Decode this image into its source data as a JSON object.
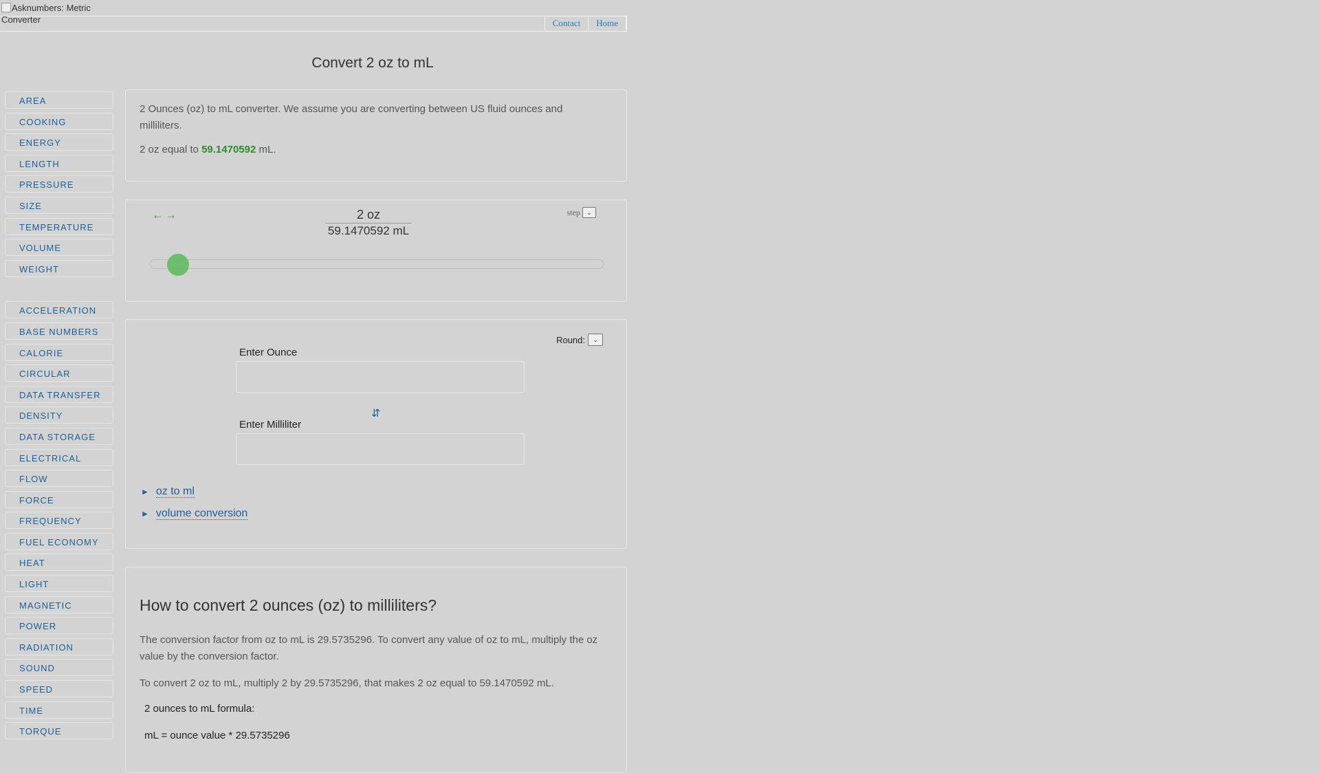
{
  "header": {
    "logo_alt": "Asknumbers: Metric Converter",
    "nav": [
      "Contact",
      "Home"
    ]
  },
  "title": "Convert 2 oz to mL",
  "sidebar": {
    "primary": [
      "AREA",
      "COOKING",
      "ENERGY",
      "LENGTH",
      "PRESSURE",
      "SIZE",
      "TEMPERATURE",
      "VOLUME",
      "WEIGHT"
    ],
    "secondary": [
      "ACCELERATION",
      "BASE NUMBERS",
      "CALORIE",
      "CIRCULAR",
      "DATA TRANSFER",
      "DENSITY",
      "DATA STORAGE",
      "ELECTRICAL",
      "FLOW",
      "FORCE",
      "FREQUENCY",
      "FUEL ECONOMY",
      "HEAT",
      "LIGHT",
      "MAGNETIC",
      "POWER",
      "RADIATION",
      "SOUND",
      "SPEED",
      "TIME",
      "TORQUE"
    ]
  },
  "summary": {
    "intro": "2 Ounces (oz) to mL converter. We assume you are converting between US fluid ounces and milliliters.",
    "equal_prefix": "2 oz equal to ",
    "equal_value": "59.1470592",
    "equal_suffix": " mL."
  },
  "slider": {
    "oz_display": "2 oz",
    "ml_display": "59.1470592 mL",
    "step_label": "step",
    "position_fraction": 0.02
  },
  "converter": {
    "round_label": "Round:",
    "ounce_label": "Enter Ounce",
    "ounce_value": "",
    "milliliter_label": "Enter Milliliter",
    "milliliter_value": "",
    "swap_icon": "⇵",
    "related": [
      "oz to ml",
      "volume conversion"
    ]
  },
  "howto": {
    "heading": "How to convert 2 ounces (oz) to milliliters?",
    "p1": "The conversion factor from oz to mL is 29.5735296. To convert any value of oz to mL, multiply the oz value by the conversion factor.",
    "p2": "To convert 2 oz to mL, multiply 2 by 29.5735296, that makes 2 oz equal to 59.1470592 mL.",
    "formula_title": "2 ounces to mL formula:",
    "formula": "mL = ounce value * 29.5735296"
  },
  "colors": {
    "link": "#1d5f97",
    "highlight": "#2e8b2e",
    "slider_thumb": "#5cb85c"
  }
}
